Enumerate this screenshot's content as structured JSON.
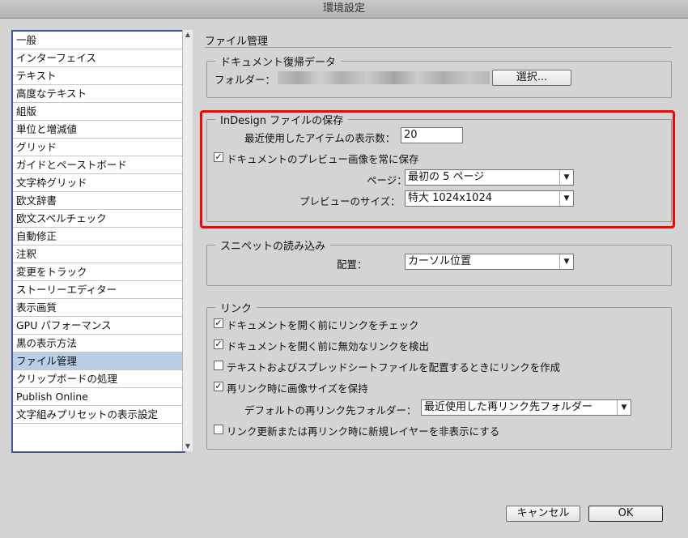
{
  "window": {
    "title": "環境設定"
  },
  "sidebar": {
    "items": [
      {
        "label": "一般"
      },
      {
        "label": "インターフェイス"
      },
      {
        "label": "テキスト"
      },
      {
        "label": "高度なテキスト"
      },
      {
        "label": "組版"
      },
      {
        "label": "単位と増減値"
      },
      {
        "label": "グリッド"
      },
      {
        "label": "ガイドとペーストボード"
      },
      {
        "label": "文字枠グリッド"
      },
      {
        "label": "欧文辞書"
      },
      {
        "label": "欧文スペルチェック"
      },
      {
        "label": "自動修正"
      },
      {
        "label": "注釈"
      },
      {
        "label": "変更をトラック"
      },
      {
        "label": "ストーリーエディター"
      },
      {
        "label": "表示画質"
      },
      {
        "label": "GPU パフォーマンス"
      },
      {
        "label": "黒の表示方法"
      },
      {
        "label": "ファイル管理"
      },
      {
        "label": "クリップボードの処理"
      },
      {
        "label": "Publish Online"
      },
      {
        "label": "文字組みプリセットの表示設定"
      }
    ],
    "selected_index": 18
  },
  "main": {
    "section_title": "ファイル管理",
    "recovery": {
      "legend": "ドキュメント復帰データ",
      "folder_label": "フォルダー：",
      "choose_button": "選択..."
    },
    "save": {
      "legend": "InDesign ファイルの保存",
      "recent_label": "最近使用したアイテムの表示数：",
      "recent_value": "20",
      "preview_checkbox_label": "ドキュメントのプレビュー画像を常に保存",
      "preview_checked": true,
      "pages_label": "ページ：",
      "pages_value": "最初の 5 ページ",
      "size_label": "プレビューのサイズ：",
      "size_value": "特大 1024x1024"
    },
    "snippet": {
      "legend": "スニペットの読み込み",
      "position_label": "配置：",
      "position_value": "カーソル位置"
    },
    "links": {
      "legend": "リンク",
      "check_before_open": {
        "label": "ドキュメントを開く前にリンクをチェック",
        "checked": true
      },
      "find_missing": {
        "label": "ドキュメントを開く前に無効なリンクを検出",
        "checked": true
      },
      "create_links": {
        "label": "テキストおよびスプレッドシートファイルを配置するときにリンクを作成",
        "checked": false
      },
      "preserve_size": {
        "label": "再リンク時に画像サイズを保持",
        "checked": true
      },
      "default_folder_label": "デフォルトの再リンク先フォルダー：",
      "default_folder_value": "最近使用した再リンク先フォルダー",
      "hide_layers": {
        "label": "リンク更新または再リンク時に新規レイヤーを非表示にする",
        "checked": false
      }
    }
  },
  "footer": {
    "cancel_label": "キャンセル",
    "ok_label": "OK"
  },
  "colors": {
    "selection": "#b9cfe6",
    "sidebar_border": "#3c5b9c",
    "highlight": "#ff0000",
    "background": "#d4d4d4"
  }
}
